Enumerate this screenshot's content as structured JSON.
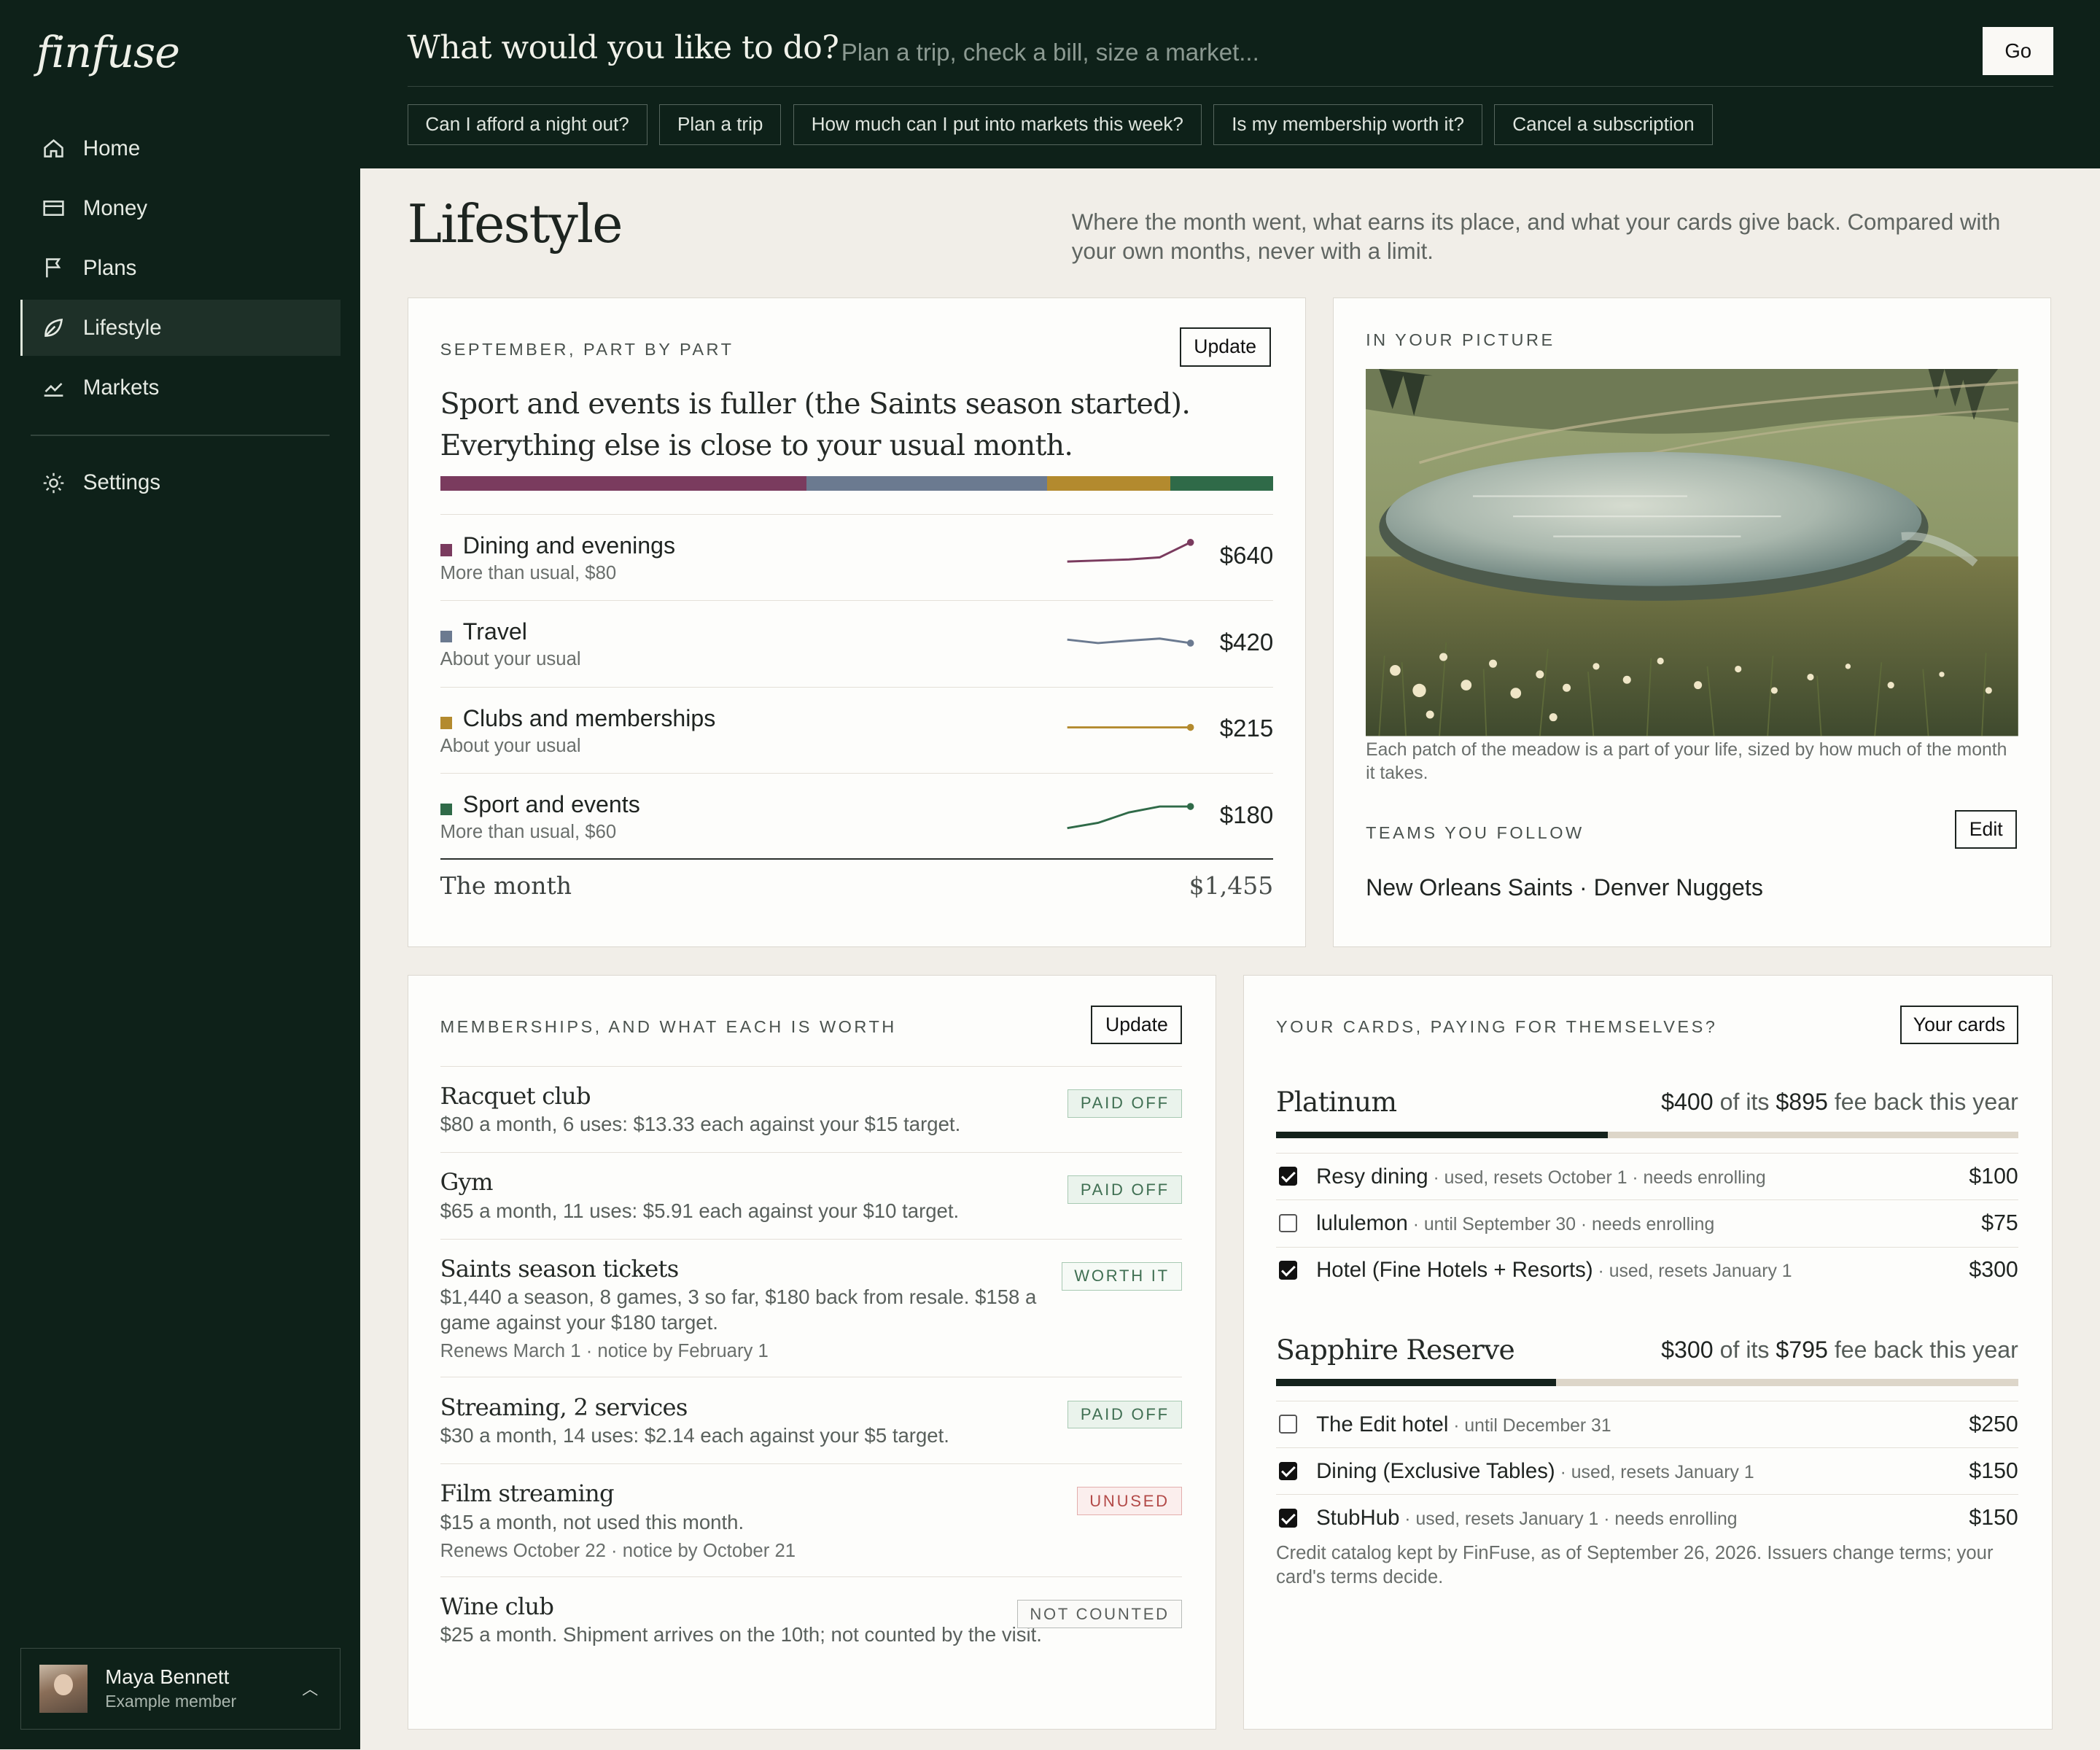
{
  "app": {
    "logo": "finfuse"
  },
  "sidebar": {
    "items": [
      {
        "label": "Home",
        "icon": "home-icon"
      },
      {
        "label": "Money",
        "icon": "wallet-icon"
      },
      {
        "label": "Plans",
        "icon": "flag-icon"
      },
      {
        "label": "Lifestyle",
        "icon": "leaf-icon",
        "active": true
      },
      {
        "label": "Markets",
        "icon": "chart-line-icon"
      }
    ],
    "settings_label": "Settings",
    "user": {
      "name": "Maya Bennett",
      "subtitle": "Example member"
    }
  },
  "topbar": {
    "prompt": "What would you like to do?",
    "placeholder": "Plan a trip, check a bill, size a market...",
    "go_label": "Go",
    "chips": [
      "Can I afford a night out?",
      "Plan a trip",
      "How much can I put into markets this week?",
      "Is my membership worth it?",
      "Cancel a subscription"
    ]
  },
  "page": {
    "title": "Lifestyle",
    "subtitle": "Where the month went, what earns its place, and what your cards give back. Compared with your own months, never with a limit."
  },
  "spending": {
    "label": "SEPTEMBER, PART BY PART",
    "update_label": "Update",
    "headline": "Sport and events is fuller (the Saints season started). Everything else is close to your usual month.",
    "categories": [
      {
        "name": "Dining and evenings",
        "note": "More than usual, $80",
        "amount": "$640",
        "value": 640,
        "color": "#7a3b5e",
        "trend": [
          0.3,
          0.33,
          0.36,
          0.42,
          0.85
        ]
      },
      {
        "name": "Travel",
        "note": "About your usual",
        "amount": "$420",
        "value": 420,
        "color": "#6b7a90",
        "trend": [
          0.55,
          0.45,
          0.52,
          0.58,
          0.45
        ]
      },
      {
        "name": "Clubs and memberships",
        "note": "About your usual",
        "amount": "$215",
        "value": 215,
        "color": "#b38a2e",
        "trend": [
          0.5,
          0.5,
          0.5,
          0.5,
          0.5
        ]
      },
      {
        "name": "Sport and events",
        "note": "More than usual, $60",
        "amount": "$180",
        "value": 180,
        "color": "#2f6a48",
        "trend": [
          0.1,
          0.25,
          0.55,
          0.72,
          0.72
        ]
      }
    ],
    "total_label": "The month",
    "total_amount": "$1,455"
  },
  "picture": {
    "label": "IN YOUR PICTURE",
    "caption": "Each patch of the meadow is a part of your life, sized by how much of the month it takes.",
    "teams_label": "TEAMS YOU FOLLOW",
    "edit_label": "Edit",
    "teams": "New Orleans Saints · Denver Nuggets"
  },
  "memberships": {
    "label": "MEMBERSHIPS, AND WHAT EACH IS WORTH",
    "update_label": "Update",
    "items": [
      {
        "name": "Racquet club",
        "desc": "$80 a month, 6 uses: $13.33 each against your $15 target.",
        "note": "",
        "badge": "PAID OFF",
        "kind": "paid"
      },
      {
        "name": "Gym",
        "desc": "$65 a month, 11 uses: $5.91 each against your $10 target.",
        "note": "",
        "badge": "PAID OFF",
        "kind": "paid"
      },
      {
        "name": "Saints season tickets",
        "desc": "$1,440 a season, 8 games, 3 so far, $180 back from resale. $158 a game against your $180 target.",
        "note": "Renews March 1 · notice by February 1",
        "badge": "WORTH IT",
        "kind": "worth"
      },
      {
        "name": "Streaming, 2 services",
        "desc": "$30 a month, 14 uses: $2.14 each against your $5 target.",
        "note": "",
        "badge": "PAID OFF",
        "kind": "paid"
      },
      {
        "name": "Film streaming",
        "desc": "$15 a month, not used this month.",
        "note": "Renews October 22 · notice by October 21",
        "badge": "UNUSED",
        "kind": "unused"
      },
      {
        "name": "Wine club",
        "desc": "$25 a month. Shipment arrives on the 10th; not counted by the visit.",
        "note": "",
        "badge": "NOT COUNTED",
        "kind": "nc"
      }
    ]
  },
  "cards": {
    "label": "YOUR CARDS, PAYING FOR THEMSELVES?",
    "button_label": "Your cards",
    "list": [
      {
        "name": "Platinum",
        "back_amount": "$400",
        "back_mid": " of its ",
        "fee": "$895",
        "back_tail": " fee back this year",
        "progress": 0.447,
        "benefits": [
          {
            "name": "Resy dining",
            "meta": " · used, resets October 1 · needs enrolling",
            "amount": "$100",
            "checked": true
          },
          {
            "name": "lululemon",
            "meta": " · until September 30 · needs enrolling",
            "amount": "$75",
            "checked": false
          },
          {
            "name": "Hotel (Fine Hotels + Resorts)",
            "meta": " · used, resets January 1",
            "amount": "$300",
            "checked": true
          }
        ]
      },
      {
        "name": "Sapphire Reserve",
        "back_amount": "$300",
        "back_mid": " of its ",
        "fee": "$795",
        "back_tail": " fee back this year",
        "progress": 0.377,
        "benefits": [
          {
            "name": "The Edit hotel",
            "meta": " · until December 31",
            "amount": "$250",
            "checked": false
          },
          {
            "name": "Dining (Exclusive Tables)",
            "meta": " · used, resets January 1",
            "amount": "$150",
            "checked": true
          },
          {
            "name": "StubHub",
            "meta": " · used, resets January 1 · needs enrolling",
            "amount": "$150",
            "checked": true
          }
        ]
      }
    ],
    "footnote": "Credit catalog kept by FinFuse, as of September 26, 2026. Issuers change terms; your card's terms decide."
  }
}
